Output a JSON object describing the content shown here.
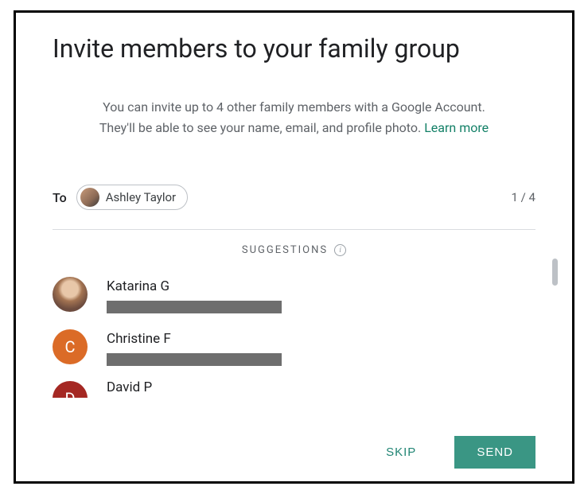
{
  "title": "Invite members to your family group",
  "subtitle_part1": "You can invite up to 4 other family members with a Google Account. They'll be able to see your name, email, and profile photo. ",
  "learn_more": "Learn more",
  "to_label": "To",
  "chip": {
    "name": "Ashley Taylor"
  },
  "counter": "1 / 4",
  "suggestions_label": "SUGGESTIONS",
  "suggestions": [
    {
      "name": "Katarina G",
      "avatar_type": "photo",
      "avatar_letter": ""
    },
    {
      "name": "Christine F",
      "avatar_type": "orange",
      "avatar_letter": "C"
    },
    {
      "name": "David P",
      "avatar_type": "maroon",
      "avatar_letter": "D"
    }
  ],
  "actions": {
    "skip": "SKIP",
    "send": "SEND"
  }
}
